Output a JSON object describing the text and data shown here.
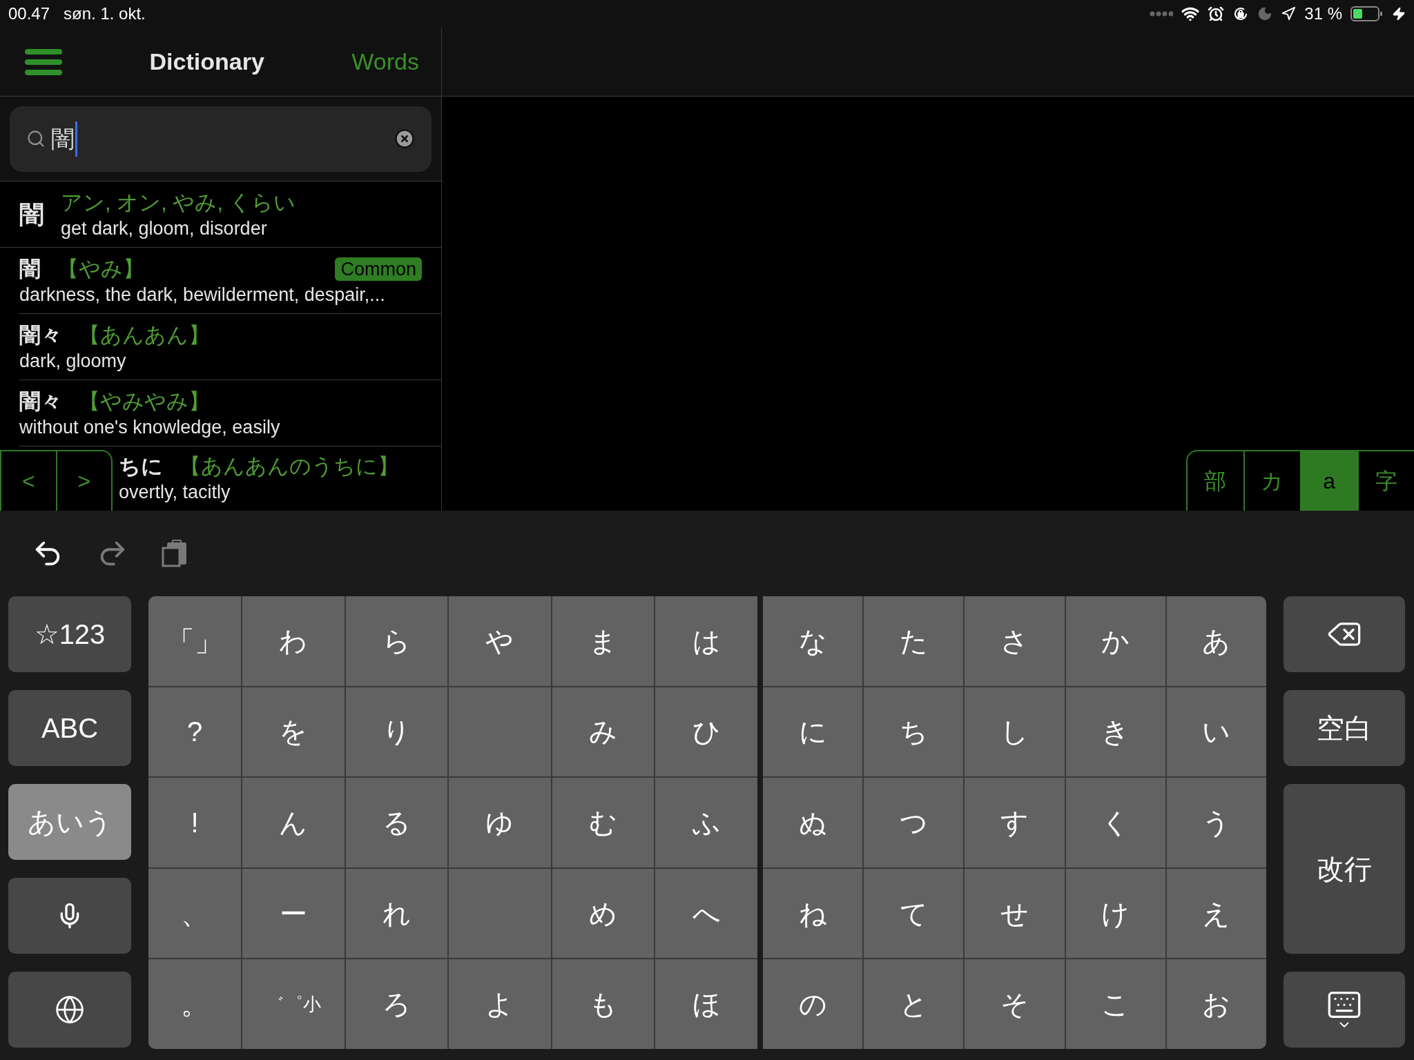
{
  "status_bar": {
    "time": "00.47",
    "date": "søn. 1. okt.",
    "battery": "31 %"
  },
  "header": {
    "title": "Dictionary",
    "action": "Words"
  },
  "search": {
    "value": "闇"
  },
  "results": [
    {
      "kind": "kanji",
      "word": "闇",
      "reading": "アン, オン, やみ, くらい",
      "meaning": "get dark, gloom, disorder"
    },
    {
      "kind": "word",
      "word": "闇",
      "reading": "【やみ】",
      "badge": "Common",
      "meaning": "darkness, the dark, bewilderment, despair,..."
    },
    {
      "kind": "word",
      "word": "闇々",
      "reading": "【あんあん】",
      "meaning": "dark, gloomy"
    },
    {
      "kind": "word",
      "word": "闇々",
      "reading": "【やみやみ】",
      "meaning": "without one's knowledge, easily"
    },
    {
      "kind": "clipped",
      "word": "ちに",
      "reading": "【あんあんのうちに】",
      "meaning": "overtly, tacitly"
    }
  ],
  "pager": [
    "<",
    ">"
  ],
  "input_modes": [
    {
      "label": "部",
      "selected": false
    },
    {
      "label": "カ",
      "selected": false
    },
    {
      "label": "a",
      "selected": true
    },
    {
      "label": "字",
      "selected": false
    }
  ],
  "keyboard": {
    "left_keys": [
      {
        "kind": "text",
        "label": "☆123",
        "selected": false
      },
      {
        "kind": "text",
        "label": "ABC",
        "selected": false
      },
      {
        "kind": "text",
        "label": "あいう",
        "selected": true
      },
      {
        "kind": "mic",
        "selected": false
      },
      {
        "kind": "globe",
        "selected": false
      }
    ],
    "kana_left": [
      [
        {
          "kind": "char",
          "label": "「」"
        },
        {
          "kind": "char",
          "label": "わ"
        },
        {
          "kind": "char",
          "label": "ら"
        },
        {
          "kind": "char",
          "label": "や"
        },
        {
          "kind": "char",
          "label": "ま"
        },
        {
          "kind": "char",
          "label": "は"
        }
      ],
      [
        {
          "kind": "char",
          "label": "?"
        },
        {
          "kind": "char",
          "label": "を"
        },
        {
          "kind": "char",
          "label": "り"
        },
        {
          "kind": "blank"
        },
        {
          "kind": "char",
          "label": "み"
        },
        {
          "kind": "char",
          "label": "ひ"
        }
      ],
      [
        {
          "kind": "char",
          "label": "!"
        },
        {
          "kind": "char",
          "label": "ん"
        },
        {
          "kind": "char",
          "label": "る"
        },
        {
          "kind": "char",
          "label": "ゆ"
        },
        {
          "kind": "char",
          "label": "む"
        },
        {
          "kind": "char",
          "label": "ふ"
        }
      ],
      [
        {
          "kind": "char",
          "label": "、"
        },
        {
          "kind": "char",
          "label": "ー"
        },
        {
          "kind": "char",
          "label": "れ"
        },
        {
          "kind": "blank"
        },
        {
          "kind": "char",
          "label": "め"
        },
        {
          "kind": "char",
          "label": "へ"
        }
      ],
      [
        {
          "kind": "char",
          "label": "。"
        },
        {
          "kind": "char",
          "label": "゛゜小"
        },
        {
          "kind": "char",
          "label": "ろ"
        },
        {
          "kind": "char",
          "label": "よ"
        },
        {
          "kind": "char",
          "label": "も"
        },
        {
          "kind": "char",
          "label": "ほ"
        }
      ]
    ],
    "kana_right": [
      [
        "な",
        "た",
        "さ",
        "か",
        "あ"
      ],
      [
        "に",
        "ち",
        "し",
        "き",
        "い"
      ],
      [
        "ぬ",
        "つ",
        "す",
        "く",
        "う"
      ],
      [
        "ね",
        "て",
        "せ",
        "け",
        "え"
      ],
      [
        "の",
        "と",
        "そ",
        "こ",
        "お"
      ]
    ],
    "right_keys": [
      {
        "kind": "delete"
      },
      {
        "kind": "text",
        "label": "空白"
      },
      {
        "kind": "tall",
        "label": "改行"
      },
      {
        "kind": "dismiss"
      }
    ]
  }
}
